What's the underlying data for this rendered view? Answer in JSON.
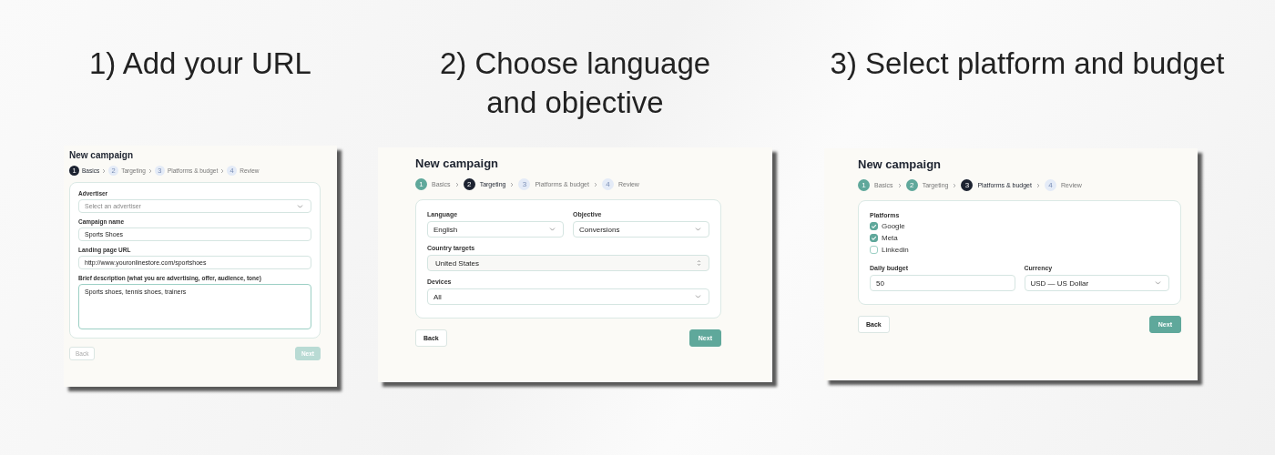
{
  "panels": [
    {
      "heading": "1) Add your URL",
      "title": "New campaign",
      "steps": [
        {
          "number": "1",
          "label": "Basics",
          "selected": true
        },
        {
          "number": "2",
          "label": "Targeting",
          "done": false,
          "selected": false
        },
        {
          "number": "3",
          "label": "Platforms & budget",
          "done": false,
          "selected": false
        },
        {
          "number": "4",
          "label": "Review",
          "done": false,
          "selected": false
        }
      ],
      "rows": [
        [
          {
            "kind": "select",
            "label": "Advertiser",
            "placeholder": "Select an advertiser"
          }
        ],
        [
          {
            "kind": "text",
            "label": "Campaign name",
            "value": "Sports Shoes"
          }
        ],
        [
          {
            "kind": "text",
            "label": "Landing page URL",
            "value": "http://www.youronlinestore.com/sportshoes"
          }
        ],
        [
          {
            "kind": "textarea",
            "label": "Brief description (what you are advertising, offer, audience, tone)",
            "value": "Sports shoes, tennis shoes, trainers"
          }
        ]
      ],
      "back": {
        "label": "Back",
        "disabled": true
      },
      "next": {
        "label": "Next",
        "disabled": true
      }
    },
    {
      "heading": "2) Choose language and objective",
      "title": "New campaign",
      "steps": [
        {
          "number": "1",
          "label": "Basics",
          "done": true,
          "selected": false
        },
        {
          "number": "2",
          "label": "Targeting",
          "selected": true
        },
        {
          "number": "3",
          "label": "Platforms & budget",
          "done": false,
          "selected": false
        },
        {
          "number": "4",
          "label": "Review",
          "done": false,
          "selected": false
        }
      ],
      "rows": [
        [
          {
            "kind": "select",
            "label": "Language",
            "value": "English"
          },
          {
            "kind": "select",
            "label": "Objective",
            "value": "Conversions"
          }
        ],
        [
          {
            "kind": "combo",
            "label": "Country targets",
            "value": "United States"
          }
        ],
        [
          {
            "kind": "select",
            "label": "Devices",
            "value": "All"
          }
        ]
      ],
      "back": {
        "label": "Back",
        "disabled": false
      },
      "next": {
        "label": "Next",
        "disabled": false
      }
    },
    {
      "heading": "3) Select platform and budget",
      "title": "New campaign",
      "steps": [
        {
          "number": "1",
          "label": "Basics",
          "done": true,
          "selected": false
        },
        {
          "number": "2",
          "label": "Targeting",
          "done": true,
          "selected": false
        },
        {
          "number": "3",
          "label": "Platforms & budget",
          "selected": true
        },
        {
          "number": "4",
          "label": "Review",
          "done": false,
          "selected": false
        }
      ],
      "rows": [
        [
          {
            "kind": "checklist",
            "label": "Platforms",
            "options": [
              {
                "label": "Google",
                "checked": true
              },
              {
                "label": "Meta",
                "checked": true
              },
              {
                "label": "Linkedin",
                "checked": false
              }
            ]
          }
        ],
        [
          {
            "kind": "text",
            "label": "Daily budget",
            "value": "50"
          },
          {
            "kind": "select",
            "label": "Currency",
            "value": "USD — US Dollar"
          }
        ]
      ],
      "back": {
        "label": "Back",
        "disabled": false
      },
      "next": {
        "label": "Next",
        "disabled": false
      }
    }
  ]
}
